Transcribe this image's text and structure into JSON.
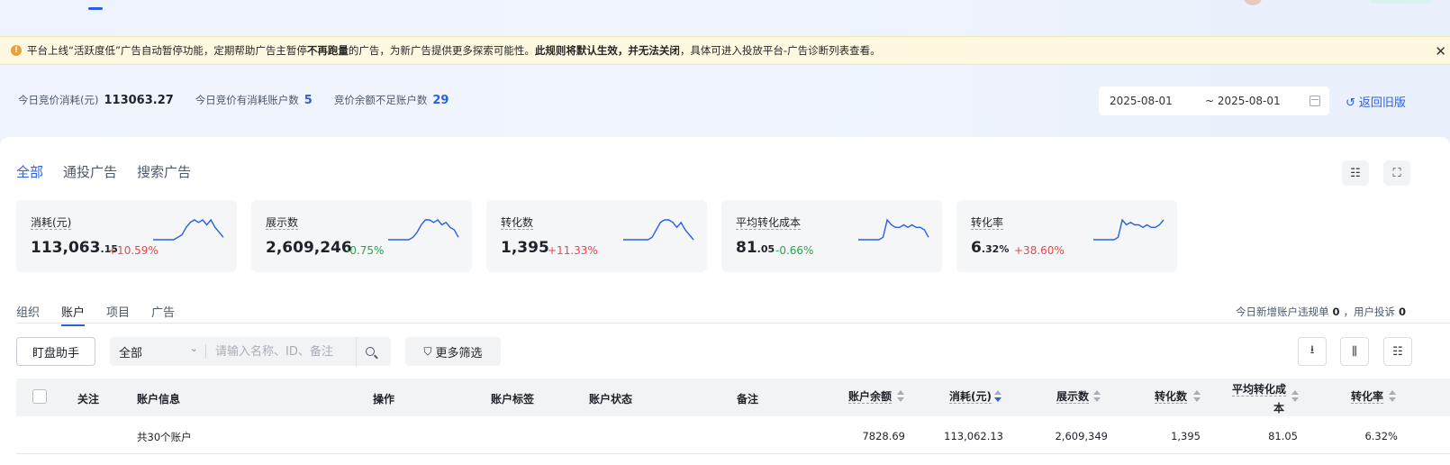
{
  "notice": {
    "p1": "平台上线“活跃度低”广告自动暂停功能，定期帮助广告主暂停",
    "p2": "不再跑量",
    "p3": "的广告，为新广告提供更多探索可能性。",
    "p4": "此规则将默认生效，并无法关闭",
    "p5": "，具体可进入投放平台-广告诊断列表查看。"
  },
  "stats": {
    "spend_label": "今日竞价消耗(元)",
    "spend_value": "113063.27",
    "accounts_label": "今日竞价有消耗账户数",
    "accounts_value": "5",
    "low_balance_label": "竞价余额不足账户数",
    "low_balance_value": "29"
  },
  "date": {
    "start": "2025-08-01",
    "end": "~ 2025-08-01"
  },
  "back_link": "返回旧版",
  "category_tabs": [
    "全部",
    "通投广告",
    "搜索广告"
  ],
  "accent": "#2b5fe0",
  "up_color": "#e8474b",
  "down_color": "#2aa54a",
  "cards": [
    {
      "label": "消耗(元)",
      "int": "113,063",
      "dec": ".15",
      "change": "+10.59%",
      "dir": "up",
      "spark": [
        1,
        1,
        1,
        1,
        1,
        1,
        2,
        3,
        6,
        8,
        9,
        8,
        9,
        7,
        9,
        6,
        4,
        2
      ]
    },
    {
      "label": "展示数",
      "int": "2,609,246",
      "dec": "",
      "change": "-0.75%",
      "dir": "down",
      "spark": [
        1,
        1,
        1,
        1,
        1,
        1,
        2,
        4,
        7,
        9,
        9,
        8,
        9,
        7,
        8,
        6,
        5,
        2
      ]
    },
    {
      "label": "转化数",
      "int": "1,395",
      "dec": "",
      "change": "+11.33%",
      "dir": "up",
      "spark": [
        1,
        1,
        1,
        1,
        1,
        1,
        1,
        2,
        5,
        8,
        9,
        9,
        8,
        6,
        8,
        5,
        3,
        1
      ]
    },
    {
      "label": "平均转化成本",
      "int": "81",
      "dec": ".05",
      "change": "-0.66%",
      "dir": "down",
      "spark": [
        1,
        1,
        1,
        1,
        1,
        1,
        2,
        9,
        7,
        6,
        6,
        7,
        6,
        7,
        6,
        6,
        5,
        2
      ]
    },
    {
      "label": "转化率",
      "int": "6",
      "dec": ".32%",
      "change": "+38.60%",
      "dir": "up",
      "spark": [
        1,
        1,
        1,
        1,
        1,
        1,
        2,
        9,
        7,
        8,
        7,
        7,
        6,
        7,
        6,
        6,
        7,
        9
      ]
    }
  ],
  "sub_tabs": [
    "组织",
    "账户",
    "项目",
    "广告"
  ],
  "sub_right": {
    "label1": "今日新增账户违规单",
    "val1": "0",
    "label2": "，用户投诉",
    "val2": "0"
  },
  "toolbar": {
    "assistant": "盯盘助手",
    "select_value": "全部",
    "search_placeholder": "请输入名称、ID、备注",
    "filter": "更多筛选"
  },
  "table": {
    "headers": {
      "follow": "关注",
      "info": "账户信息",
      "ops": "操作",
      "tags": "账户标签",
      "status": "账户状态",
      "remark": "备注",
      "balance": "账户余额",
      "spend": "消耗(元)",
      "impressions": "展示数",
      "conversions": "转化数",
      "cpa1": "平均转化成",
      "cpa2": "本",
      "cvr": "转化率"
    },
    "summary": {
      "label": "共30个账户",
      "balance": "7828.69",
      "spend": "113,062.13",
      "impressions": "2,609,349",
      "conversions": "1,395",
      "cpa": "81.05",
      "cvr": "6.32%"
    }
  }
}
